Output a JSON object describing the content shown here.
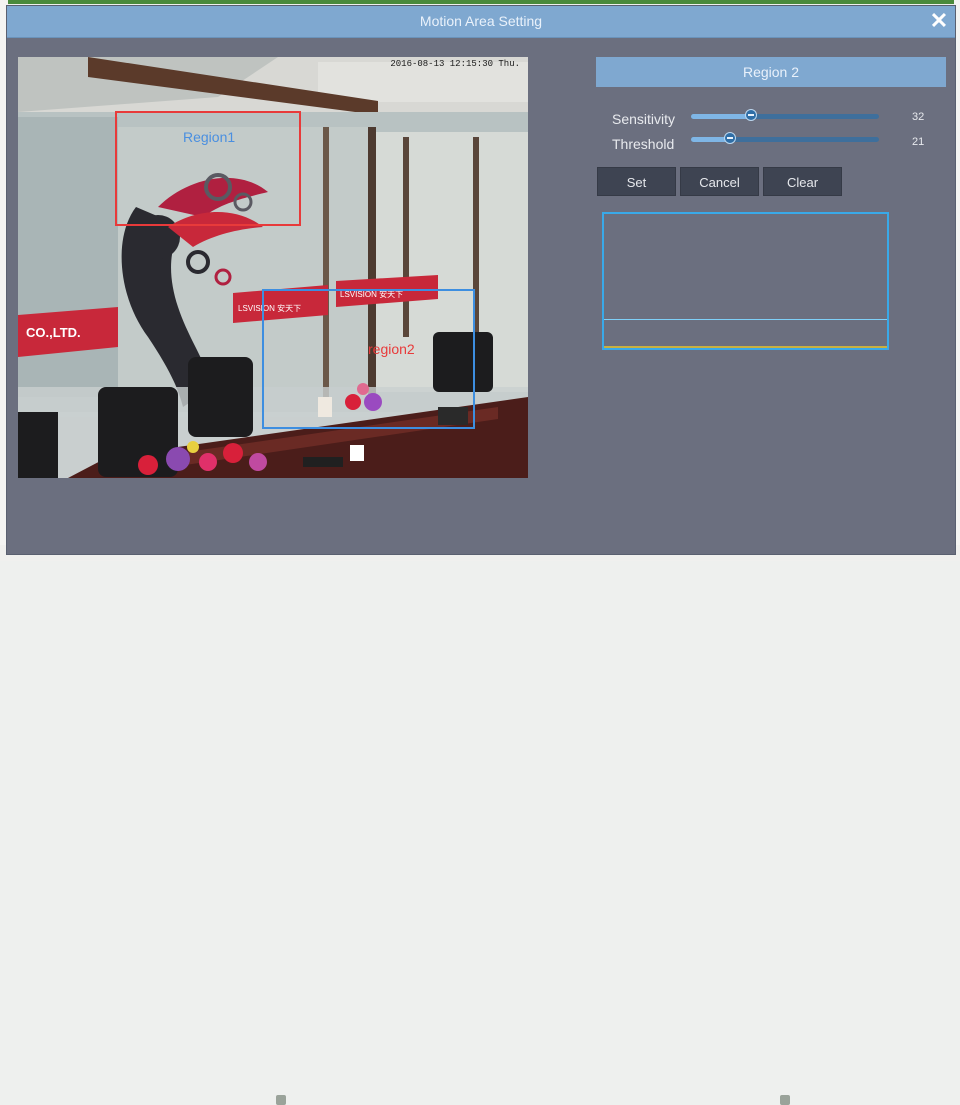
{
  "dialog": {
    "title": "Motion Area Setting",
    "close_icon": "close-icon"
  },
  "camera": {
    "osd_time": "2016-08-13 12:15:30 Thu.",
    "regions": [
      {
        "label": "Region1",
        "color": "#e83a3a"
      },
      {
        "label": "region2",
        "color": "#3d8ee0"
      }
    ]
  },
  "panel": {
    "region_title": "Region 2",
    "sensitivity": {
      "label": "Sensitivity",
      "value": "32",
      "level_percent": 32
    },
    "threshold": {
      "label": "Threshold",
      "value": "21",
      "level_percent": 21
    },
    "buttons": {
      "set": "Set",
      "cancel": "Cancel",
      "clear": "Clear"
    }
  },
  "colors": {
    "accent": "#7fa8d0",
    "dialog_bg": "#6b6f7f",
    "button_bg": "#3e4452",
    "preview_border": "#39a9e8"
  }
}
